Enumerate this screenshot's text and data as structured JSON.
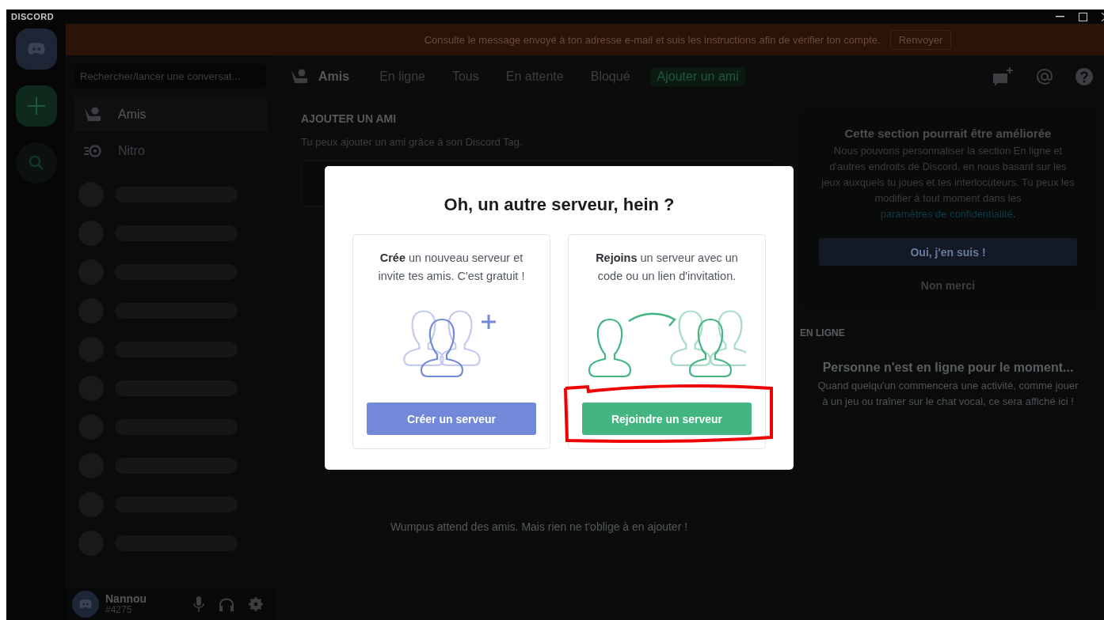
{
  "window": {
    "title": "DISCORD"
  },
  "banner": {
    "message": "Consulte le message envoyé à ton adresse e-mail et suis les instructions afin de vérifier ton compte.",
    "button": "Renvoyer"
  },
  "search": {
    "placeholder": "Rechercher/lancer une conversat..."
  },
  "sidebar": {
    "items": [
      {
        "kind": "friends",
        "label": "Amis",
        "selected": true
      },
      {
        "kind": "nitro",
        "label": "Nitro",
        "selected": false
      }
    ]
  },
  "user": {
    "name": "Nannou",
    "tag": "#4275"
  },
  "header": {
    "title": "Amis",
    "tabs": [
      {
        "label": "En ligne",
        "selected": false
      },
      {
        "label": "Tous",
        "selected": false
      },
      {
        "label": "En attente",
        "selected": false
      },
      {
        "label": "Bloqué",
        "selected": false
      },
      {
        "label": "Ajouter un ami",
        "selected": true
      }
    ]
  },
  "add_friend": {
    "heading": "AJOUTER UN AMI",
    "subtitle": "Tu peux ajouter un ami grâce à son Discord Tag."
  },
  "empty_text": "Wumpus attend des amis. Mais rien ne t'oblige à en ajouter !",
  "promo": {
    "title": "Cette section pourrait être améliorée",
    "text": "Nous pouvons personnaliser la section En ligne et d'autres endroits de Discord, en nous basant sur les jeux auxquels tu joues et tes interlocuteurs. Tu peux les modifier à tout moment dans les ",
    "link": "paramètres de confidentialité",
    "after_link": ".",
    "primary_button": "Oui, j'en suis !",
    "secondary_button": "Non merci"
  },
  "online": {
    "heading": "EN LIGNE",
    "title": "Personne n'est en ligne pour le moment...",
    "text": "Quand quelqu'un commencera une activité, comme jouer à un jeu ou traîner sur le chat vocal, ce sera affiché ici !"
  },
  "modal": {
    "title": "Oh, un autre serveur, hein ?",
    "options": [
      {
        "kind": "create",
        "text": "**Crée** un nouveau serveur et invite tes amis. C'est gratuit !",
        "button": "Créer un serveur",
        "color": "#7289da",
        "highlighted": false
      },
      {
        "kind": "join",
        "text": "**Rejoins** un serveur avec un code ou un lien d'invitation.",
        "button": "Rejoindre un serveur",
        "color": "#43b581",
        "highlighted": true
      }
    ]
  }
}
